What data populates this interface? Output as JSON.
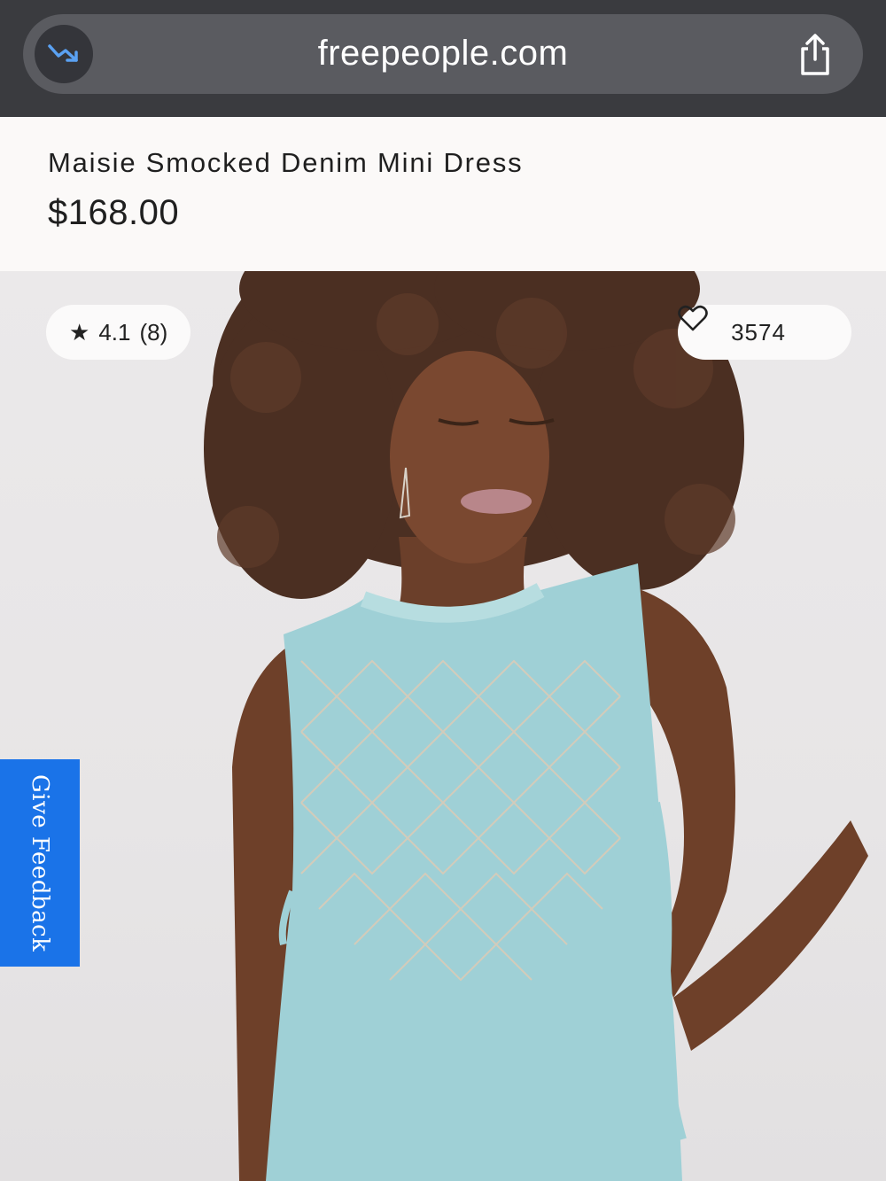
{
  "browser": {
    "url": "freepeople.com",
    "trend_icon": "trending-down-icon",
    "share_icon": "share-icon"
  },
  "product": {
    "title": "Maisie Smocked Denim Mini Dress",
    "price": "$168.00"
  },
  "rating": {
    "star": "★",
    "value": "4.1",
    "count": "(8)"
  },
  "likes": {
    "count": "3574",
    "icon": "heart-outline-icon"
  },
  "feedback": {
    "label": "Give Feedback",
    "color": "#1a73e8"
  }
}
